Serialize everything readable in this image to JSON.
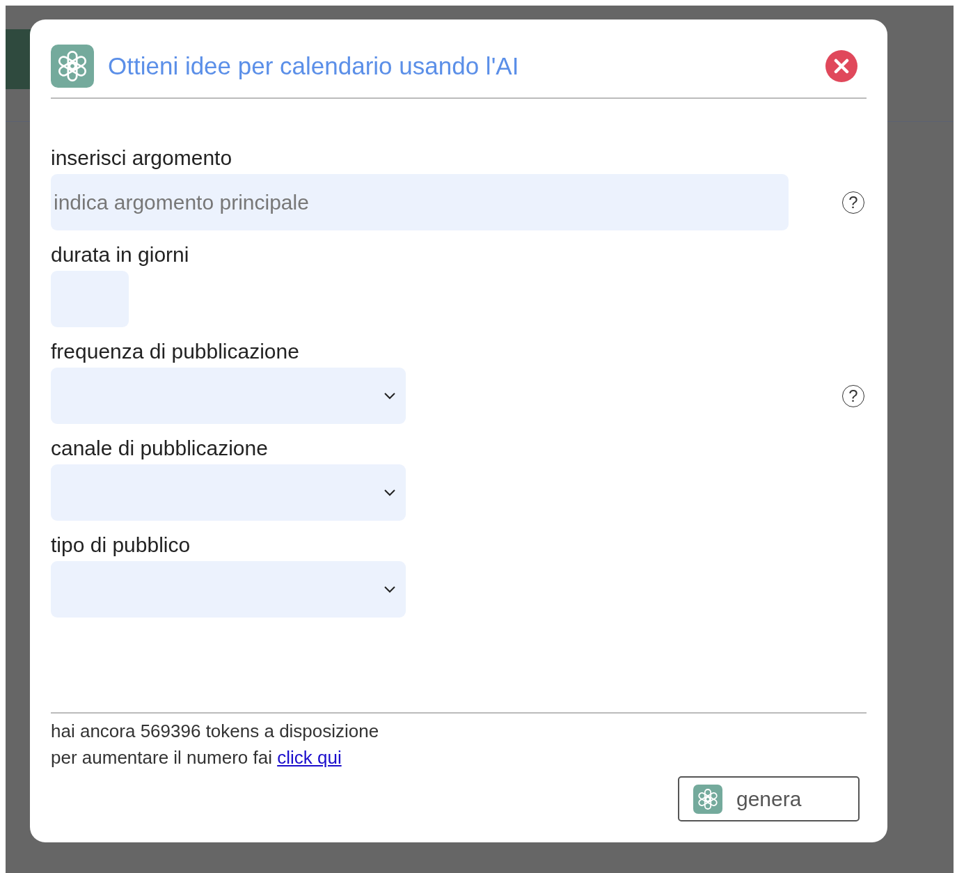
{
  "dialog": {
    "title": "Ottieni idee per calendario usando l'AI",
    "fields": [
      {
        "kind": "text",
        "label": "inserisci argomento",
        "placeholder": "indica argomento principale",
        "help": true
      },
      {
        "kind": "number",
        "label": "durata in giorni",
        "help": false
      },
      {
        "kind": "select",
        "label": "frequenza di pubblicazione",
        "help": true
      },
      {
        "kind": "select",
        "label": "canale di pubblicazione",
        "help": false
      },
      {
        "kind": "select",
        "label": "tipo di pubblico",
        "help": false
      }
    ],
    "help_glyph": "?",
    "tokens_text": "hai ancora 569396 tokens a disposizione",
    "increase_text": "per aumentare il numero fai",
    "increase_link": "click qui",
    "generate_button": "genera"
  }
}
